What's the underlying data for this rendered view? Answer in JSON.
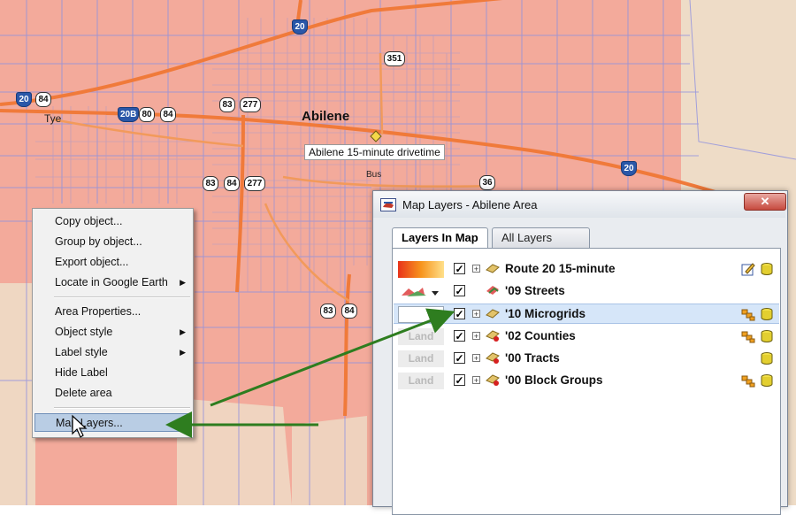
{
  "map": {
    "places": {
      "city": "Abilene",
      "town": "Tye"
    },
    "callout": "Abilene 15-minute drivetime",
    "shields": {
      "i20_north": "20",
      "i20_west": "20",
      "i20_east": "20",
      "bus_i20": "20B",
      "us84_west": "84",
      "us80": "80",
      "us84_b": "84",
      "us83_a": "83",
      "us277_a": "277",
      "loop351": "351",
      "us83_b": "83",
      "us84_c": "84",
      "us277_b": "277",
      "bus_label": "Bus",
      "sh36": "36",
      "us83_c": "83",
      "us84_d": "84"
    }
  },
  "context_menu": {
    "items": [
      {
        "label": "Copy object..."
      },
      {
        "label": "Group by object..."
      },
      {
        "label": "Export object..."
      },
      {
        "label": "Locate in Google Earth",
        "submenu": true
      },
      {
        "label": "Area Properties..."
      },
      {
        "label": "Object style",
        "submenu": true
      },
      {
        "label": "Label style",
        "submenu": true
      },
      {
        "label": "Hide Label"
      },
      {
        "label": "Delete area"
      },
      {
        "label": "Map Layers...",
        "selected": true
      }
    ]
  },
  "dialog": {
    "title": "Map Layers - Abilene Area",
    "close": "✕",
    "tabs": [
      {
        "label": "Layers In Map",
        "active": true
      },
      {
        "label": "All Layers",
        "active": false
      }
    ],
    "layers": [
      {
        "name": "Route 20 15-minute",
        "checked": true,
        "swatch": "gradient"
      },
      {
        "name": "'09 Streets",
        "checked": true,
        "swatch": "streets"
      },
      {
        "name": "'10 Microgrids",
        "checked": true,
        "swatch": "empty",
        "highlight": true
      },
      {
        "name": "'02 Counties",
        "checked": true,
        "swatch": "Land"
      },
      {
        "name": "'00 Tracts",
        "checked": true,
        "swatch": "Land"
      },
      {
        "name": "'00 Block Groups",
        "checked": true,
        "swatch": "Land"
      }
    ],
    "check_glyph": "✓",
    "expand_glyph": "+"
  },
  "colors": {
    "drivetime_fill": "#f3aa9b",
    "road": "#f07a3a",
    "street": "#b09fbf",
    "grid": "#8f90e0",
    "annotation_arrow": "#2e7d1f"
  }
}
